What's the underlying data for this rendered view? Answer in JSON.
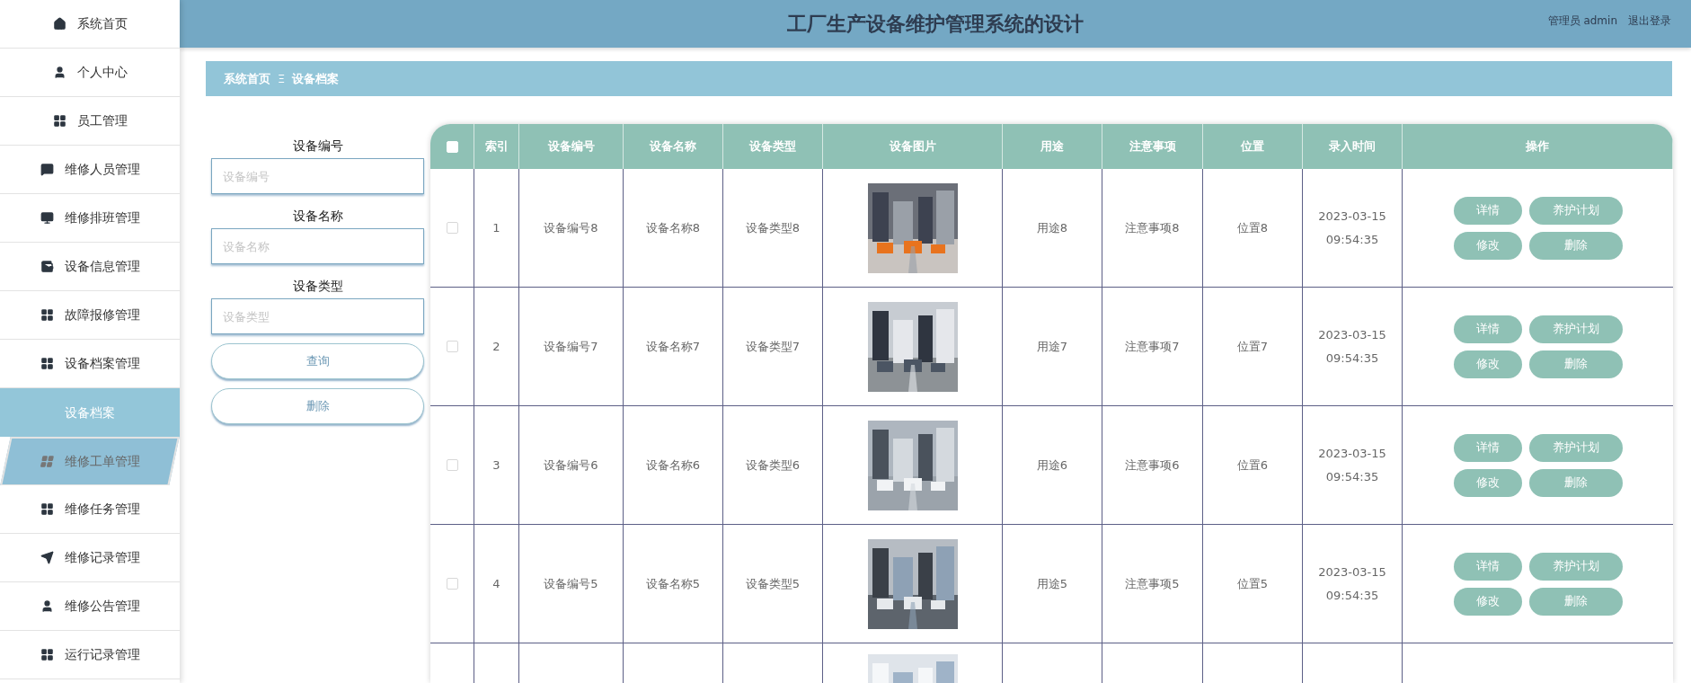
{
  "header": {
    "title": "工厂生产设备维护管理系统的设计",
    "user_label": "管理员 admin",
    "logout": "退出登录"
  },
  "sidebar": {
    "items": [
      {
        "label": "系统首页",
        "selected": false,
        "hovered": false
      },
      {
        "label": "个人中心",
        "selected": false,
        "hovered": false
      },
      {
        "label": "员工管理",
        "selected": false,
        "hovered": false
      },
      {
        "label": "维修人员管理",
        "selected": false,
        "hovered": false
      },
      {
        "label": "维修排班管理",
        "selected": false,
        "hovered": false
      },
      {
        "label": "设备信息管理",
        "selected": false,
        "hovered": false
      },
      {
        "label": "故障报修管理",
        "selected": false,
        "hovered": false
      },
      {
        "label": "设备档案管理",
        "selected": false,
        "hovered": false,
        "children": [
          {
            "label": "设备档案",
            "selected": true
          }
        ]
      },
      {
        "label": "维修工单管理",
        "selected": false,
        "hovered": true
      },
      {
        "label": "维修任务管理",
        "selected": false,
        "hovered": false
      },
      {
        "label": "维修记录管理",
        "selected": false,
        "hovered": false
      },
      {
        "label": "维修公告管理",
        "selected": false,
        "hovered": false
      },
      {
        "label": "运行记录管理",
        "selected": false,
        "hovered": false
      }
    ]
  },
  "breadcrumb": {
    "items": [
      "系统首页",
      "设备档案"
    ],
    "separator": "Ξ"
  },
  "filters": [
    {
      "label": "设备编号",
      "placeholder": "设备编号"
    },
    {
      "label": "设备名称",
      "placeholder": "设备名称"
    },
    {
      "label": "设备类型",
      "placeholder": "设备类型"
    }
  ],
  "filter_buttons": [
    "查询",
    "删除"
  ],
  "table": {
    "select_all": {
      "checked": false
    },
    "columns": [
      "索引",
      "设备编号",
      "设备名称",
      "设备类型",
      "设备图片",
      "用途",
      "注意事项",
      "位置",
      "录入时间",
      "操作"
    ],
    "rows": [
      {
        "checked": false,
        "index": "1",
        "code": "设备编号8",
        "name": "设备名称8",
        "type": "设备类型8",
        "usage": "用途8",
        "notes": "注意事项8",
        "location": "位置8",
        "time": "2023-03-15 09:54:35",
        "actions": [
          "详情",
          "养护计划",
          "修改",
          "删除"
        ]
      },
      {
        "checked": false,
        "index": "2",
        "code": "设备编号7",
        "name": "设备名称7",
        "type": "设备类型7",
        "usage": "用途7",
        "notes": "注意事项7",
        "location": "位置7",
        "time": "2023-03-15 09:54:35",
        "actions": [
          "详情",
          "养护计划",
          "修改",
          "删除"
        ]
      },
      {
        "checked": false,
        "index": "3",
        "code": "设备编号6",
        "name": "设备名称6",
        "type": "设备类型6",
        "usage": "用途6",
        "notes": "注意事项6",
        "location": "位置6",
        "time": "2023-03-15 09:54:35",
        "actions": [
          "详情",
          "养护计划",
          "修改",
          "删除"
        ]
      },
      {
        "checked": false,
        "index": "4",
        "code": "设备编号5",
        "name": "设备名称5",
        "type": "设备类型5",
        "usage": "用途5",
        "notes": "注意事项5",
        "location": "位置5",
        "time": "2023-03-15 09:54:35",
        "actions": [
          "详情",
          "养护计划",
          "修改",
          "删除"
        ]
      }
    ]
  }
}
